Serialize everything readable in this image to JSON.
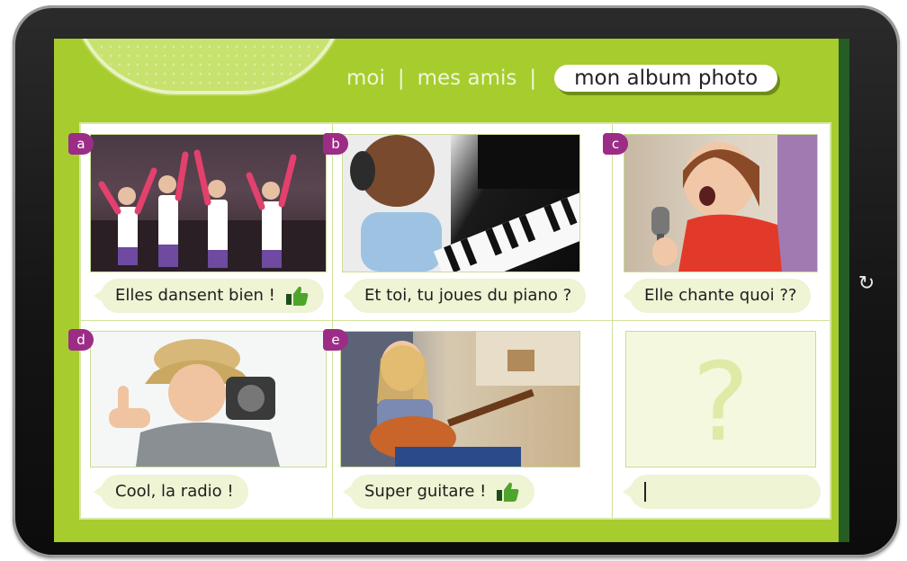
{
  "nav": {
    "items": [
      {
        "label": "moi",
        "active": false
      },
      {
        "label": "mes amis",
        "active": false
      },
      {
        "label": "mon album photo",
        "active": true
      }
    ],
    "separator": "|"
  },
  "album": {
    "photos": [
      {
        "letter": "a",
        "caption": "Elles dansent bien !",
        "like": true,
        "icon": "thumbs-up-icon"
      },
      {
        "letter": "b",
        "caption": "Et toi, tu joues du piano ?",
        "like": false
      },
      {
        "letter": "c",
        "caption": "Elle chante quoi ??",
        "like": false
      },
      {
        "letter": "d",
        "caption": "Cool, la radio !",
        "like": false
      },
      {
        "letter": "e",
        "caption": "Super guitare !",
        "like": true,
        "icon": "thumbs-up-icon"
      }
    ],
    "mystery": {
      "symbol": "?",
      "caption": ""
    }
  },
  "colors": {
    "screen": "#a7cc2e",
    "badge": "#9c2d86",
    "bubble": "#eef4d4",
    "frame": "#151515"
  }
}
